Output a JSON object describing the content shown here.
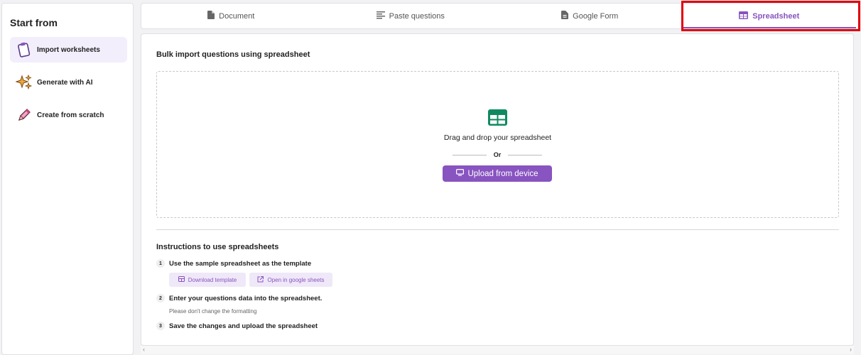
{
  "sidebar": {
    "title": "Start from",
    "items": [
      {
        "label": "Import worksheets",
        "icon": "clipboard-icon",
        "active": true
      },
      {
        "label": "Generate with AI",
        "icon": "sparkle-icon",
        "active": false
      },
      {
        "label": "Create from scratch",
        "icon": "pencil-icon",
        "active": false
      }
    ]
  },
  "tabs": [
    {
      "label": "Document",
      "icon": "document-icon"
    },
    {
      "label": "Paste questions",
      "icon": "lines-icon"
    },
    {
      "label": "Google Form",
      "icon": "form-icon"
    },
    {
      "label": "Spreadsheet",
      "icon": "spreadsheet-icon",
      "active": true
    }
  ],
  "main": {
    "bulk_title": "Bulk import questions using spreadsheet",
    "dropzone": {
      "text": "Drag and drop your spreadsheet",
      "or": "Or",
      "upload_label": "Upload from device"
    },
    "instructions": {
      "title": "Instructions to use spreadsheets",
      "steps": [
        {
          "num": "1",
          "text": "Use the sample spreadsheet as the template"
        },
        {
          "num": "2",
          "text": "Enter your questions data into the spreadsheet."
        },
        {
          "num": "3",
          "text": "Save the changes and upload the spreadsheet"
        }
      ],
      "download_label": "Download template",
      "open_label": "Open in google sheets",
      "note": "Please don't change the formatting"
    }
  },
  "colors": {
    "accent": "#8854c0",
    "accent_light": "#efe8f8",
    "sheet_green": "#0f8a5f",
    "highlight": "#e0000b"
  }
}
